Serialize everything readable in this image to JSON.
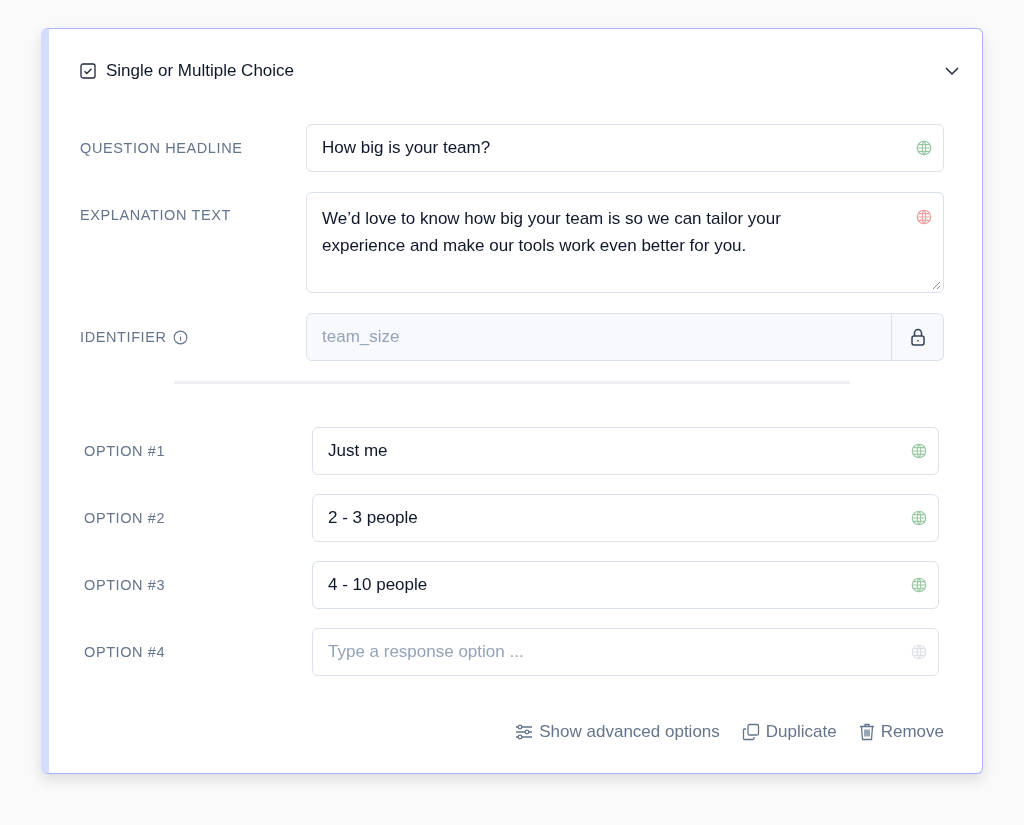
{
  "card": {
    "title": "Single or Multiple Choice",
    "expanded": true
  },
  "fields": [
    {
      "kind": "input",
      "label": "QUESTION HEADLINE",
      "value": "How big is your team?",
      "color": "#9cc9a4"
    },
    {
      "kind": "textarea",
      "label": "EXPLANATION TEXT",
      "value": "We’d love to know how big your team is so we can tailor your experience and make our tools work even better for you.",
      "color": "#eba3a3"
    },
    {
      "kind": "locked",
      "label": "IDENTIFIER",
      "value": "team_size",
      "info": true
    }
  ],
  "options": [
    {
      "label": "OPTION #1",
      "value": "Just me",
      "color": "#9cc9a4"
    },
    {
      "label": "OPTION #2",
      "value": "2 - 3 people",
      "color": "#9cc9a4"
    },
    {
      "label": "OPTION #3",
      "value": "4 - 10 people",
      "color": "#9cc9a4"
    },
    {
      "label": "OPTION #4",
      "placeholder": "Type a response option ...",
      "color": "#dfe2e8"
    }
  ],
  "actions": [
    {
      "kind": "advanced",
      "label": "Show advanced options"
    },
    {
      "kind": "duplicate",
      "label": "Duplicate"
    },
    {
      "kind": "remove",
      "label": "Remove"
    }
  ]
}
